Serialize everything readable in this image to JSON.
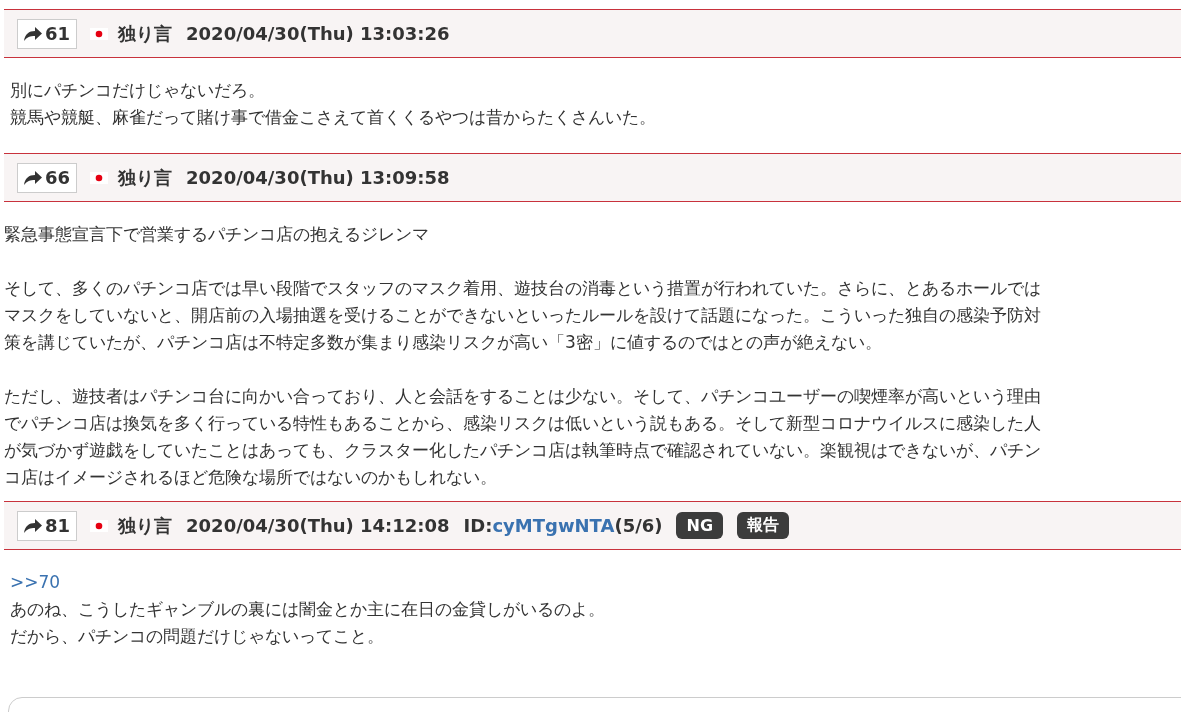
{
  "posts": [
    {
      "number": "61",
      "name": "独り言",
      "date": "2020/04/30(Thu) 13:03:26",
      "paragraphs": [
        [
          "別にパチンコだけじゃないだろ。",
          "競馬や競艇、麻雀だって賭け事で借金こさえて首くくるやつは昔からたくさんいた。"
        ]
      ]
    },
    {
      "number": "66",
      "name": "独り言",
      "date": "2020/04/30(Thu) 13:09:58",
      "paragraphs": [
        [
          "緊急事態宣言下で営業するパチンコ店の抱えるジレンマ"
        ],
        [
          "そして、多くのパチンコ店では早い段階でスタッフのマスク着用、遊技台の消毒という措置が行われていた。さらに、とあるホールでは",
          "マスクをしていないと、開店前の入場抽選を受けることができないといったルールを設けて話題になった。こういった独自の感染予防対",
          "策を講じていたが、パチンコ店は不特定多数が集まり感染リスクが高い「3密」に値するのではとの声が絶えない。"
        ],
        [
          "ただし、遊技者はパチンコ台に向かい合っており、人と会話をすることは少ない。そして、パチンコユーザーの喫煙率が高いという理由",
          "でパチンコ店は換気を多く行っている特性もあることから、感染リスクは低いという説もある。そして新型コロナウイルスに感染した人",
          "が気づかず遊戯をしていたことはあっても、クラスター化したパチンコ店は執筆時点で確認されていない。楽観視はできないが、パチン",
          "コ店はイメージされるほど危険な場所ではないのかもしれない。"
        ]
      ]
    },
    {
      "number": "81",
      "name": "独り言",
      "date": "2020/04/30(Thu) 14:12:08",
      "id": {
        "prefix": "ID:",
        "value": "cyMTgwNTA",
        "count": "(5/6)"
      },
      "buttons": [
        "NG",
        "報告"
      ],
      "anchor": ">>70",
      "paragraphs": [
        [
          "あのね、こうしたギャンブルの裏には闇金とか主に在日の金貸しがいるのよ。",
          "だから、パチンコの問題だけじゃないってこと。"
        ]
      ]
    }
  ]
}
